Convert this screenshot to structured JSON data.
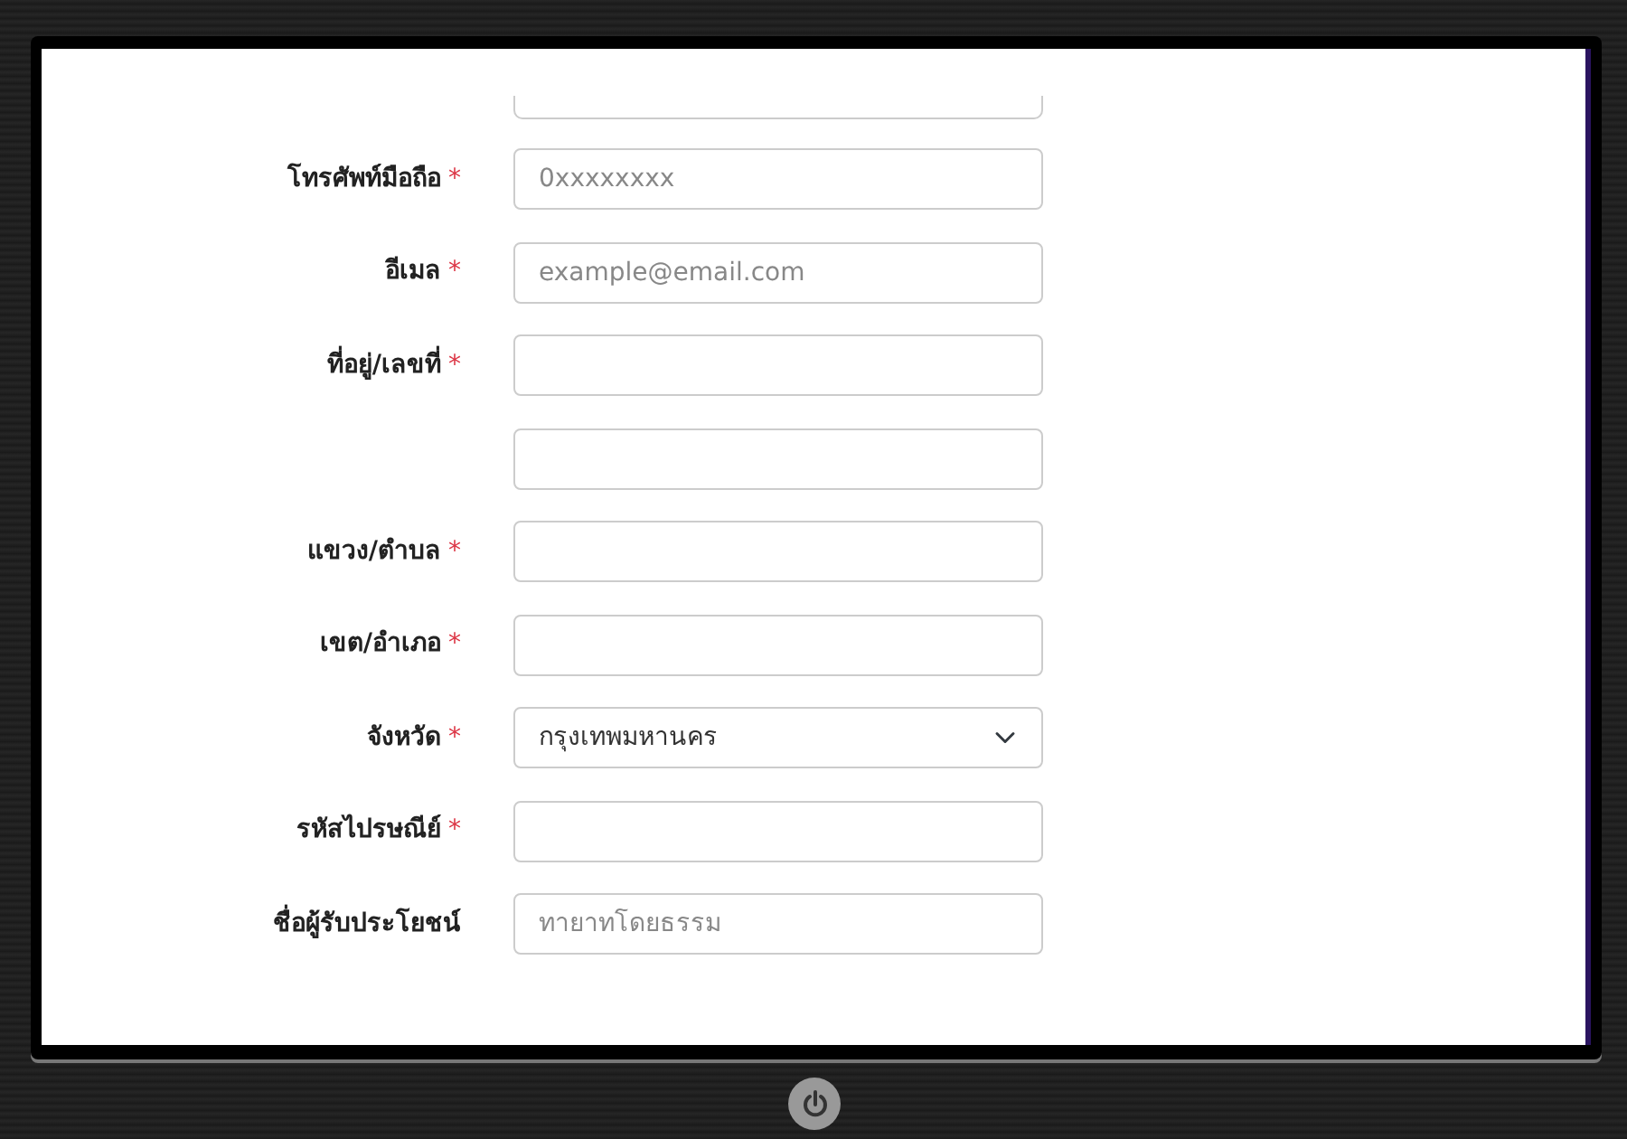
{
  "top_field_cut": true,
  "fields": [
    {
      "label": "โทรศัพท์มือถือ",
      "required_mark": "*",
      "kind": "input",
      "placeholder": "0xxxxxxxx"
    },
    {
      "label": "อีเมล",
      "required_mark": "*",
      "kind": "input",
      "placeholder": "example@email.com"
    },
    {
      "label": "ที่อยู่/เลขที่",
      "required_mark": "*",
      "kind": "input"
    },
    {
      "kind": "input"
    },
    {
      "label": "แขวง/ตำบล",
      "required_mark": "*",
      "kind": "input"
    },
    {
      "label": "เขต/อำเภอ",
      "required_mark": "*",
      "kind": "input"
    },
    {
      "label": "จังหวัด",
      "required_mark": "*",
      "kind": "select",
      "value": "กรุงเทพมหานคร"
    },
    {
      "label": "รหัสไปรษณีย์",
      "required_mark": "*",
      "kind": "input"
    },
    {
      "label": "ชื่อผู้รับประโยชน์",
      "kind": "input",
      "placeholder": "ทายาทโดยธรรม"
    }
  ]
}
